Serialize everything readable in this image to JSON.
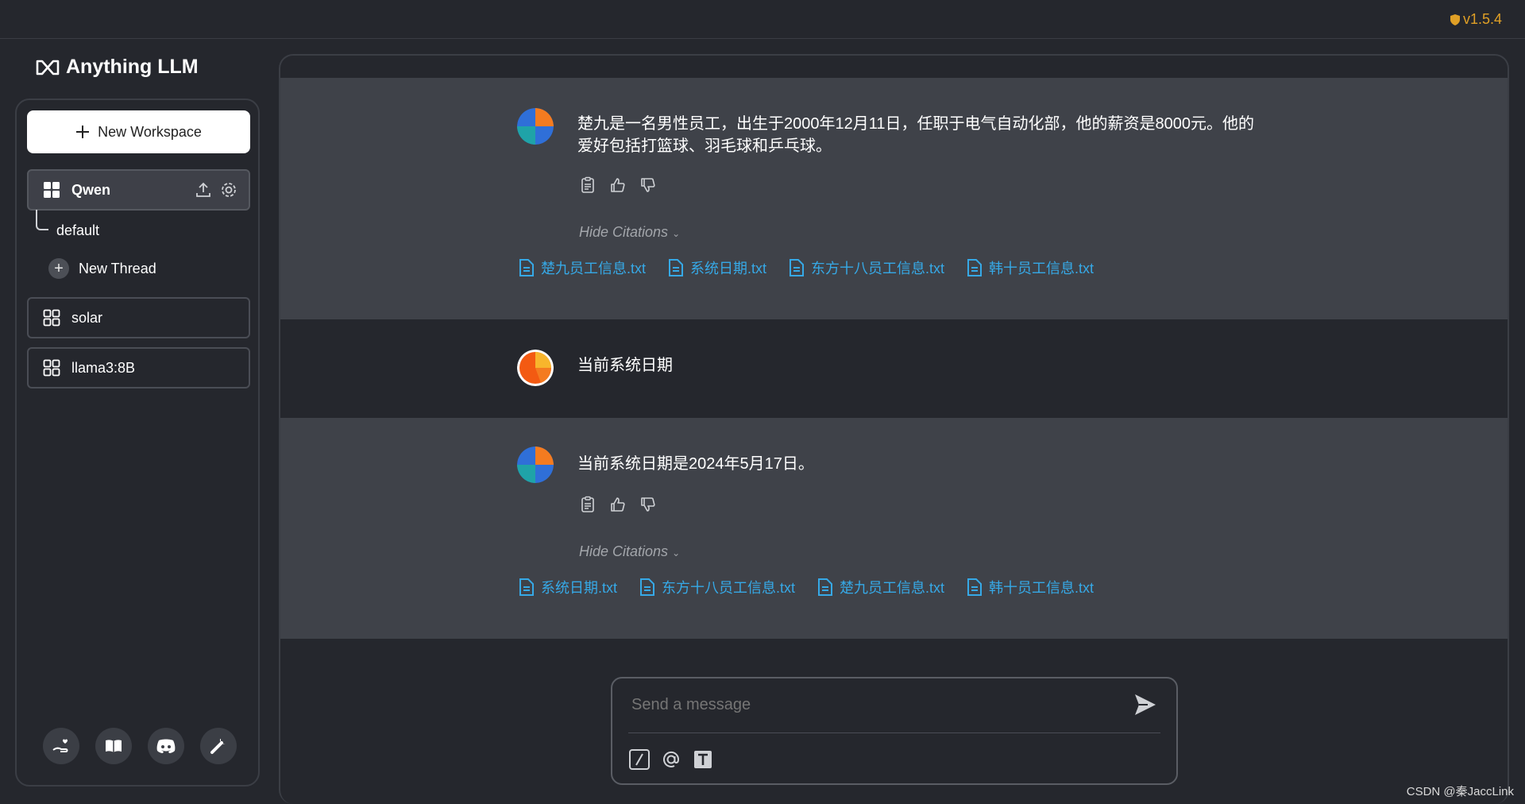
{
  "version": "v1.5.4",
  "app": {
    "title": "Anything LLM"
  },
  "sidebar": {
    "new_workspace_label": "New Workspace",
    "workspaces": [
      {
        "name": "Qwen",
        "active": true
      },
      {
        "name": "solar",
        "active": false
      },
      {
        "name": "llama3:8B",
        "active": false
      }
    ],
    "thread_default": "default",
    "new_thread_label": "New Thread",
    "footer_icons": [
      "hand-heart-icon",
      "book-icon",
      "discord-icon",
      "wrench-icon"
    ]
  },
  "chat": {
    "messages": [
      {
        "role": "assistant",
        "text": "楚九是一名男性员工，出生于2000年12月11日，任职于电气自动化部，他的薪资是8000元。他的爱好包括打篮球、羽毛球和乒乓球。",
        "hide_citations_label": "Hide Citations",
        "citations": [
          "楚九员工信息.txt",
          "系统日期.txt",
          "东方十八员工信息.txt",
          "韩十员工信息.txt"
        ]
      },
      {
        "role": "user",
        "text": "当前系统日期"
      },
      {
        "role": "assistant",
        "text": "当前系统日期是2024年5月17日。",
        "hide_citations_label": "Hide Citations",
        "citations": [
          "系统日期.txt",
          "东方十八员工信息.txt",
          "楚九员工信息.txt",
          "韩十员工信息.txt"
        ]
      }
    ]
  },
  "composer": {
    "placeholder": "Send a message"
  },
  "watermark": "CSDN @秦JaccLink",
  "colors": {
    "accent_link": "#36a9e7",
    "version": "#e0a026",
    "background": "#25272d",
    "assistant_bg": "#3f4249"
  }
}
